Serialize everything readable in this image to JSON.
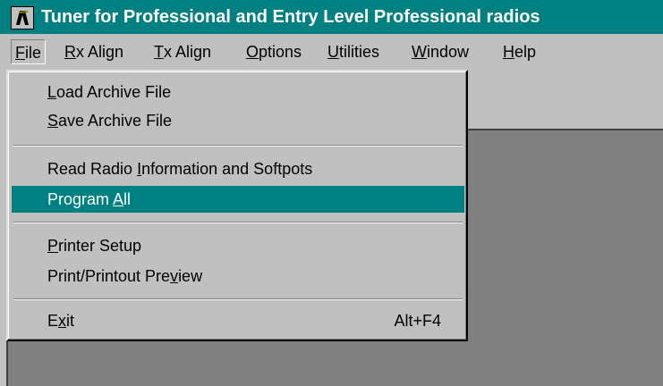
{
  "window": {
    "title": "Tuner for Professional and Entry Level Professional radios",
    "icon": "tuner-app-icon",
    "title_bar_color": "#008080"
  },
  "menubar": {
    "items": [
      {
        "pre": "",
        "key": "F",
        "post": "ile"
      },
      {
        "pre": "",
        "key": "R",
        "post": "x Align"
      },
      {
        "pre": "",
        "key": "T",
        "post": "x Align"
      },
      {
        "pre": "",
        "key": "O",
        "post": "ptions"
      },
      {
        "pre": "",
        "key": "U",
        "post": "tilities"
      },
      {
        "pre": "",
        "key": "W",
        "post": "indow"
      },
      {
        "pre": "",
        "key": "H",
        "post": "elp"
      }
    ]
  },
  "file_menu": {
    "items": [
      {
        "pre": "",
        "key": "L",
        "post": "oad Archive File"
      },
      {
        "pre": "",
        "key": "S",
        "post": "ave Archive File"
      },
      {
        "pre": "Read Radio ",
        "key": "I",
        "post": "nformation and Softpots"
      },
      {
        "pre": "Program ",
        "key": "A",
        "post": "ll"
      },
      {
        "pre": "",
        "key": "P",
        "post": "rinter Setup"
      },
      {
        "pre": "Print/Printout Pre",
        "key": "v",
        "post": "iew"
      },
      {
        "pre": "E",
        "key": "x",
        "post": "it",
        "shortcut": "Alt+F4"
      }
    ],
    "highlight_color": "#008080"
  }
}
